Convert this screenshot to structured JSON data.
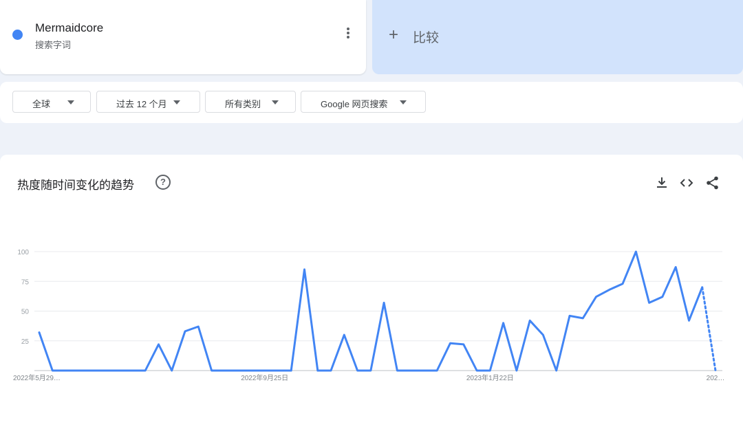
{
  "term": {
    "name": "Mermaidcore",
    "type": "搜索字词"
  },
  "compare": {
    "label": "比较"
  },
  "filters": [
    {
      "label": "全球"
    },
    {
      "label": "过去 12 个月"
    },
    {
      "label": "所有类别"
    },
    {
      "label": "Google 网页搜索"
    }
  ],
  "chart_card": {
    "title": "热度随时间变化的趋势"
  },
  "colors": {
    "series": "#4285f4",
    "accent_bg": "#d2e3fc"
  },
  "chart_data": {
    "type": "line",
    "title": "",
    "ylim": [
      0,
      100
    ],
    "yticks": [
      25,
      50,
      75,
      100
    ],
    "grid": true,
    "x_tick_labels": [
      "2022年5月29…",
      "2022年9月25日",
      "2023年1月22日",
      "202…"
    ],
    "x_tick_index": [
      0,
      17,
      34,
      51
    ],
    "dotted_last_segment": true,
    "series": [
      {
        "values": [
          32,
          0,
          0,
          0,
          0,
          0,
          0,
          0,
          0,
          22,
          0,
          33,
          37,
          0,
          0,
          0,
          0,
          0,
          0,
          0,
          85,
          0,
          0,
          30,
          0,
          0,
          57,
          0,
          0,
          0,
          0,
          23,
          22,
          0,
          0,
          40,
          0,
          42,
          30,
          0,
          46,
          44,
          62,
          68,
          73,
          100,
          57,
          62,
          87,
          42,
          70,
          0
        ]
      }
    ]
  }
}
